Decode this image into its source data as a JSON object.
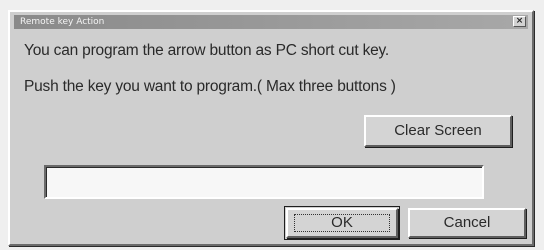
{
  "window": {
    "title": "Remote key Action",
    "close_glyph": "×"
  },
  "messages": {
    "line1": "You can program the arrow button as PC short cut key.",
    "line2": "Push the key you want to program.( Max three buttons )"
  },
  "buttons": {
    "clear_screen": "Clear Screen",
    "ok": "OK",
    "cancel": "Cancel"
  },
  "key_input": {
    "value": ""
  }
}
